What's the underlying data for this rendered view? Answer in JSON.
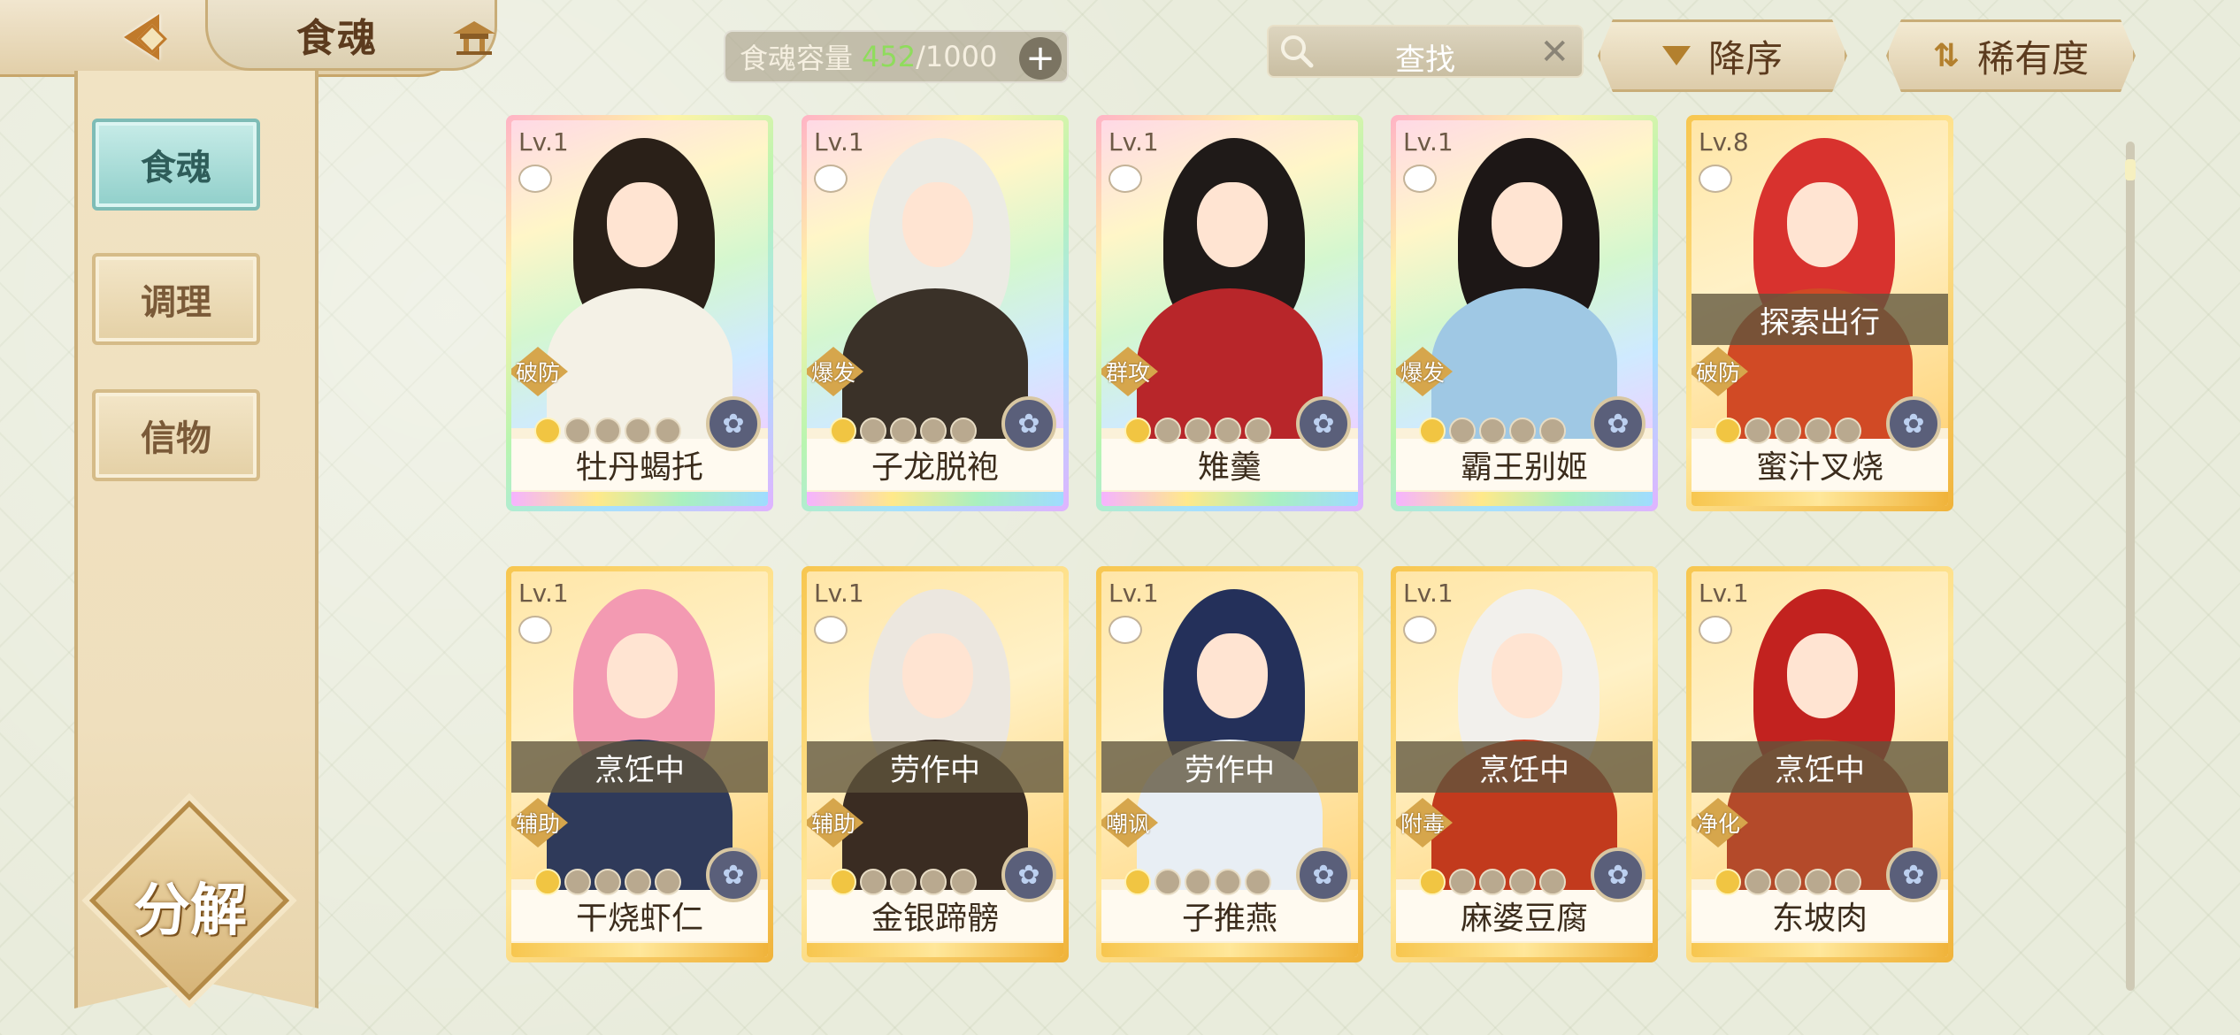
{
  "header": {
    "title": "食魂",
    "capacity_label": "食魂容量",
    "capacity_current": "452",
    "capacity_max": "/1000",
    "capacity_add": "+",
    "search_placeholder": "查找",
    "search_clear": "✕",
    "sort_label": "降序",
    "rarity_label": "稀有度"
  },
  "sidebar": {
    "items": [
      {
        "label": "食魂",
        "active": true
      },
      {
        "label": "调理",
        "active": false
      },
      {
        "label": "信物",
        "active": false
      }
    ],
    "decompose_label": "分解"
  },
  "cards": [
    {
      "level": "Lv.1",
      "name": "牡丹蝎托",
      "role": "破防",
      "status": "",
      "rarity": "rainbow",
      "stars": 1,
      "hair_color": "#2a2018",
      "outfit_color": "#f4f1e6"
    },
    {
      "level": "Lv.1",
      "name": "子龙脱袍",
      "role": "爆发",
      "status": "",
      "rarity": "rainbow",
      "stars": 1,
      "hair_color": "#ecebe4",
      "outfit_color": "#3a3128"
    },
    {
      "level": "Lv.1",
      "name": "雉羹",
      "role": "群攻",
      "status": "",
      "rarity": "rainbow",
      "stars": 1,
      "hair_color": "#1f1a18",
      "outfit_color": "#b8262a"
    },
    {
      "level": "Lv.1",
      "name": "霸王别姬",
      "role": "爆发",
      "status": "",
      "rarity": "rainbow",
      "stars": 1,
      "hair_color": "#1d1716",
      "outfit_color": "#9fc8e4"
    },
    {
      "level": "Lv.8",
      "name": "蜜汁叉烧",
      "role": "破防",
      "status": "探索出行",
      "rarity": "gold",
      "stars": 1,
      "hair_color": "#d8322e",
      "outfit_color": "#d14a25"
    },
    {
      "level": "Lv.1",
      "name": "干烧虾仁",
      "role": "辅助",
      "status": "烹饪中",
      "rarity": "gold",
      "stars": 1,
      "hair_color": "#f39ab2",
      "outfit_color": "#2f3a5a"
    },
    {
      "level": "Lv.1",
      "name": "金银蹄髈",
      "role": "辅助",
      "status": "劳作中",
      "rarity": "gold",
      "stars": 1,
      "hair_color": "#ece7df",
      "outfit_color": "#3a2c22"
    },
    {
      "level": "Lv.1",
      "name": "子推燕",
      "role": "嘲讽",
      "status": "劳作中",
      "rarity": "gold",
      "stars": 1,
      "hair_color": "#24305a",
      "outfit_color": "#e8eef4"
    },
    {
      "level": "Lv.1",
      "name": "麻婆豆腐",
      "role": "附毒",
      "status": "烹饪中",
      "rarity": "gold",
      "stars": 1,
      "hair_color": "#f2f0ec",
      "outfit_color": "#c23a1d"
    },
    {
      "level": "Lv.1",
      "name": "东坡肉",
      "role": "净化",
      "status": "烹饪中",
      "rarity": "gold",
      "stars": 1,
      "hair_color": "#c2221f",
      "outfit_color": "#b44a2a"
    }
  ],
  "colors": {
    "capacity_current": "#8fdc5c",
    "active_tab": "#90cfca",
    "gold_frame": "#f7c64f"
  },
  "icons": {
    "back": "back-arrow-icon",
    "pavilion": "pavilion-icon",
    "search": "search-icon",
    "clear": "close-icon",
    "sort": "triangle-down-icon",
    "rarity": "sort-bars-icon",
    "egg": "egg-icon",
    "emblem": "flower-emblem-icon"
  }
}
